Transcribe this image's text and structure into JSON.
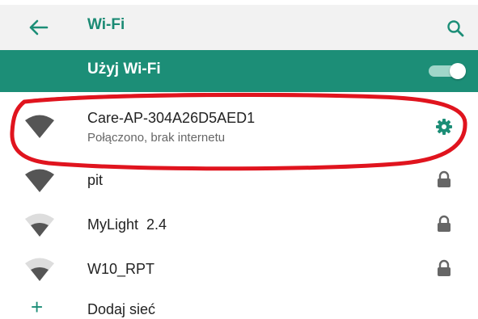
{
  "appbar": {
    "title": "Wi-Fi"
  },
  "master": {
    "label": "Użyj Wi-Fi",
    "enabled": true
  },
  "networks": [
    {
      "name": "Care-AP-304A26D5AED1",
      "status": "Połączono, brak internetu",
      "trailing_icon": "settings-gear-icon",
      "signal": "full",
      "locked": false
    },
    {
      "name": "pit",
      "trailing_icon": "lock-icon",
      "signal": "full",
      "locked": true
    },
    {
      "name": "MyLight  2.4",
      "trailing_icon": "lock-icon",
      "signal": "weak",
      "locked": true
    },
    {
      "name": "W10_RPT",
      "trailing_icon": "lock-icon",
      "signal": "weak",
      "locked": true
    }
  ],
  "add_network": {
    "label": "Dodaj sieć"
  },
  "colors": {
    "accent": "#1c8e77",
    "annotation": "#e0141e",
    "appbar_bg": "#f2f2f2"
  }
}
